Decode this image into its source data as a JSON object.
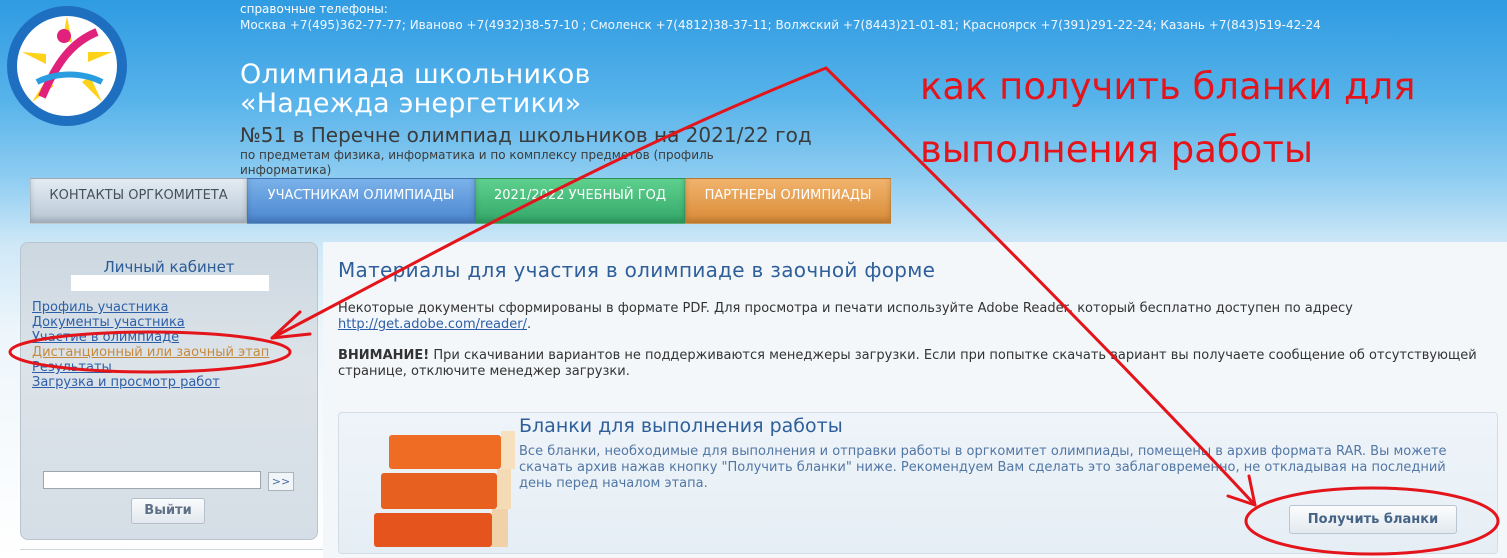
{
  "header": {
    "phones_label": "справочные телефоны:",
    "phones": "Москва +7(495)362-77-77; Иваново +7(4932)38-57-10 ; Смоленск +7(4812)38-37-11; Волжский +7(8443)21-01-81; Красноярск +7(391)291-22-24; Казань +7(843)519-42-24",
    "title_line1": "Олимпиада школьников",
    "title_line2": "«Надежда энергетики»",
    "subtitle": "№51 в Перечне олимпиад школьников на 2021/22 год",
    "subtitle_small": "по предметам физика, информатика и по комплексу предметов (профиль информатика)"
  },
  "annotation": {
    "text": "как получить бланки для выполнения работы",
    "color": "#e4141b"
  },
  "menu": {
    "items": [
      {
        "label": "КОНТАКТЫ ОРГКОМИТЕТА"
      },
      {
        "label": "УЧАСТНИКАМ ОЛИМПИАДЫ"
      },
      {
        "label": "2021/2022 УЧЕБНЫЙ ГОД"
      },
      {
        "label": "ПАРТНЕРЫ ОЛИМПИАДЫ"
      }
    ]
  },
  "sidebar": {
    "title": "Личный кабинет",
    "links": [
      {
        "label": "Профиль участника"
      },
      {
        "label": "Документы участника"
      },
      {
        "label": "Участие в олимпиаде"
      },
      {
        "label": "Дистанционный или заочный этап"
      },
      {
        "label": "Результаты"
      },
      {
        "label": "Загрузка и просмотр работ"
      }
    ],
    "go_label": ">>",
    "logout_label": "Выйти"
  },
  "main": {
    "title": "Материалы для участия в олимпиаде в заочной форме",
    "p1_text": "Некоторые документы сформированы в формате PDF. Для просмотра и печати используйте Adobe Reader, который бесплатно доступен по адресу",
    "p1_link": "http://get.adobe.com/reader/",
    "p2_bold": "ВНИМАНИЕ!",
    "p2_text": " При скачивании вариантов не поддерживаются менеджеры загрузки. Если при попытке скачать вариант вы получаете сообщение об отсутствующей странице, отключите менеджер загрузки.",
    "card": {
      "title": "Бланки для выполнения работы",
      "text": "Все бланки, необходимые для выполнения и отправки работы в оргкомитет олимпиады, помещены в архив формата RAR. Вы можете скачать архив нажав кнопку \"Получить бланки\" ниже. Рекомендуем Вам сделать это заблаговременно, не откладывая на последний день перед началом этапа.",
      "button_label": "Получить бланки"
    }
  }
}
